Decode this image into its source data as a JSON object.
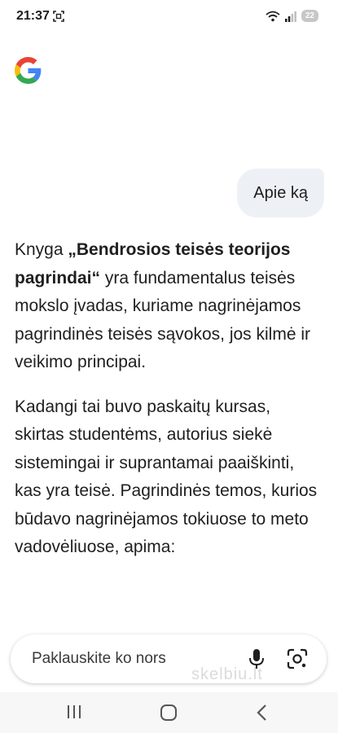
{
  "status_bar": {
    "time": "21:37",
    "battery": "22"
  },
  "chat": {
    "user_message": "Apie ką",
    "answer": {
      "p1_prefix": "Knyga ",
      "p1_bold": "„Bendrosios teisės teorijos pagrindai“",
      "p1_suffix": " yra fundamentalus teisės mokslo įvadas, kuriame nagrinėjamos pagrindinės teisės sąvokos, jos kilmė ir veikimo principai.",
      "p2": "Kadangi tai buvo paskaitų kursas, skirtas studentėms, autorius siekė sistemingai ir suprantamai paaiškinti, kas yra teisė. Pagrindinės temos, kurios būdavo nagrinėjamos tokiuose to meto vadovėliuose, apima:"
    }
  },
  "input": {
    "placeholder": "Paklauskite ko nors"
  },
  "watermark": "skelbiu.lt",
  "icons": {
    "logo": "google-g-logo",
    "mic": "microphone-icon",
    "lens": "google-lens-icon",
    "nav": [
      "recent-apps-icon",
      "home-icon",
      "back-icon"
    ]
  },
  "colors": {
    "google_blue": "#4285F4",
    "google_red": "#EA4335",
    "google_yellow": "#FBBC05",
    "google_green": "#34A853",
    "bubble_bg": "#edf1f6"
  }
}
